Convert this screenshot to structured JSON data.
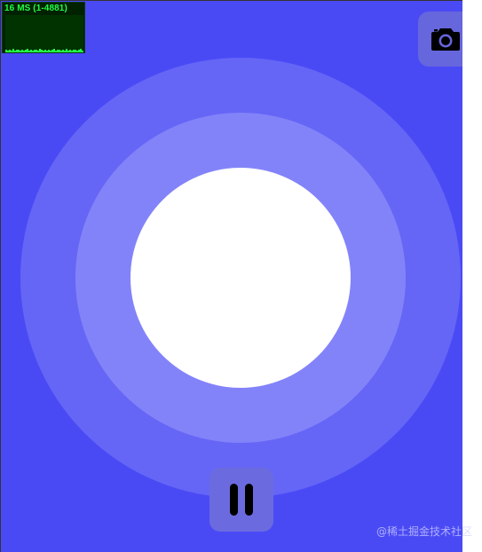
{
  "stats": {
    "label": "16 MS (1-4881)",
    "color": "#22ff44",
    "samples": [
      3,
      2,
      3,
      2,
      4,
      2,
      3,
      3,
      2,
      3,
      2,
      3,
      4,
      2,
      3,
      2,
      3,
      3,
      2,
      4,
      3,
      2,
      3,
      2,
      3,
      2,
      3,
      4,
      2,
      3,
      3,
      2,
      3,
      2,
      4,
      2,
      3,
      2,
      3,
      3,
      2,
      3,
      4,
      2
    ]
  },
  "rings": {
    "outer_color": "#6566f6",
    "middle_color": "#8383f9",
    "core_color": "#ffffff"
  },
  "controls": {
    "camera_icon": "camera-icon",
    "pause_icon": "pause-icon"
  },
  "watermark": "@稀土掘金技术社区",
  "colors": {
    "background": "#4a4af5",
    "accent": "#22ff44"
  }
}
